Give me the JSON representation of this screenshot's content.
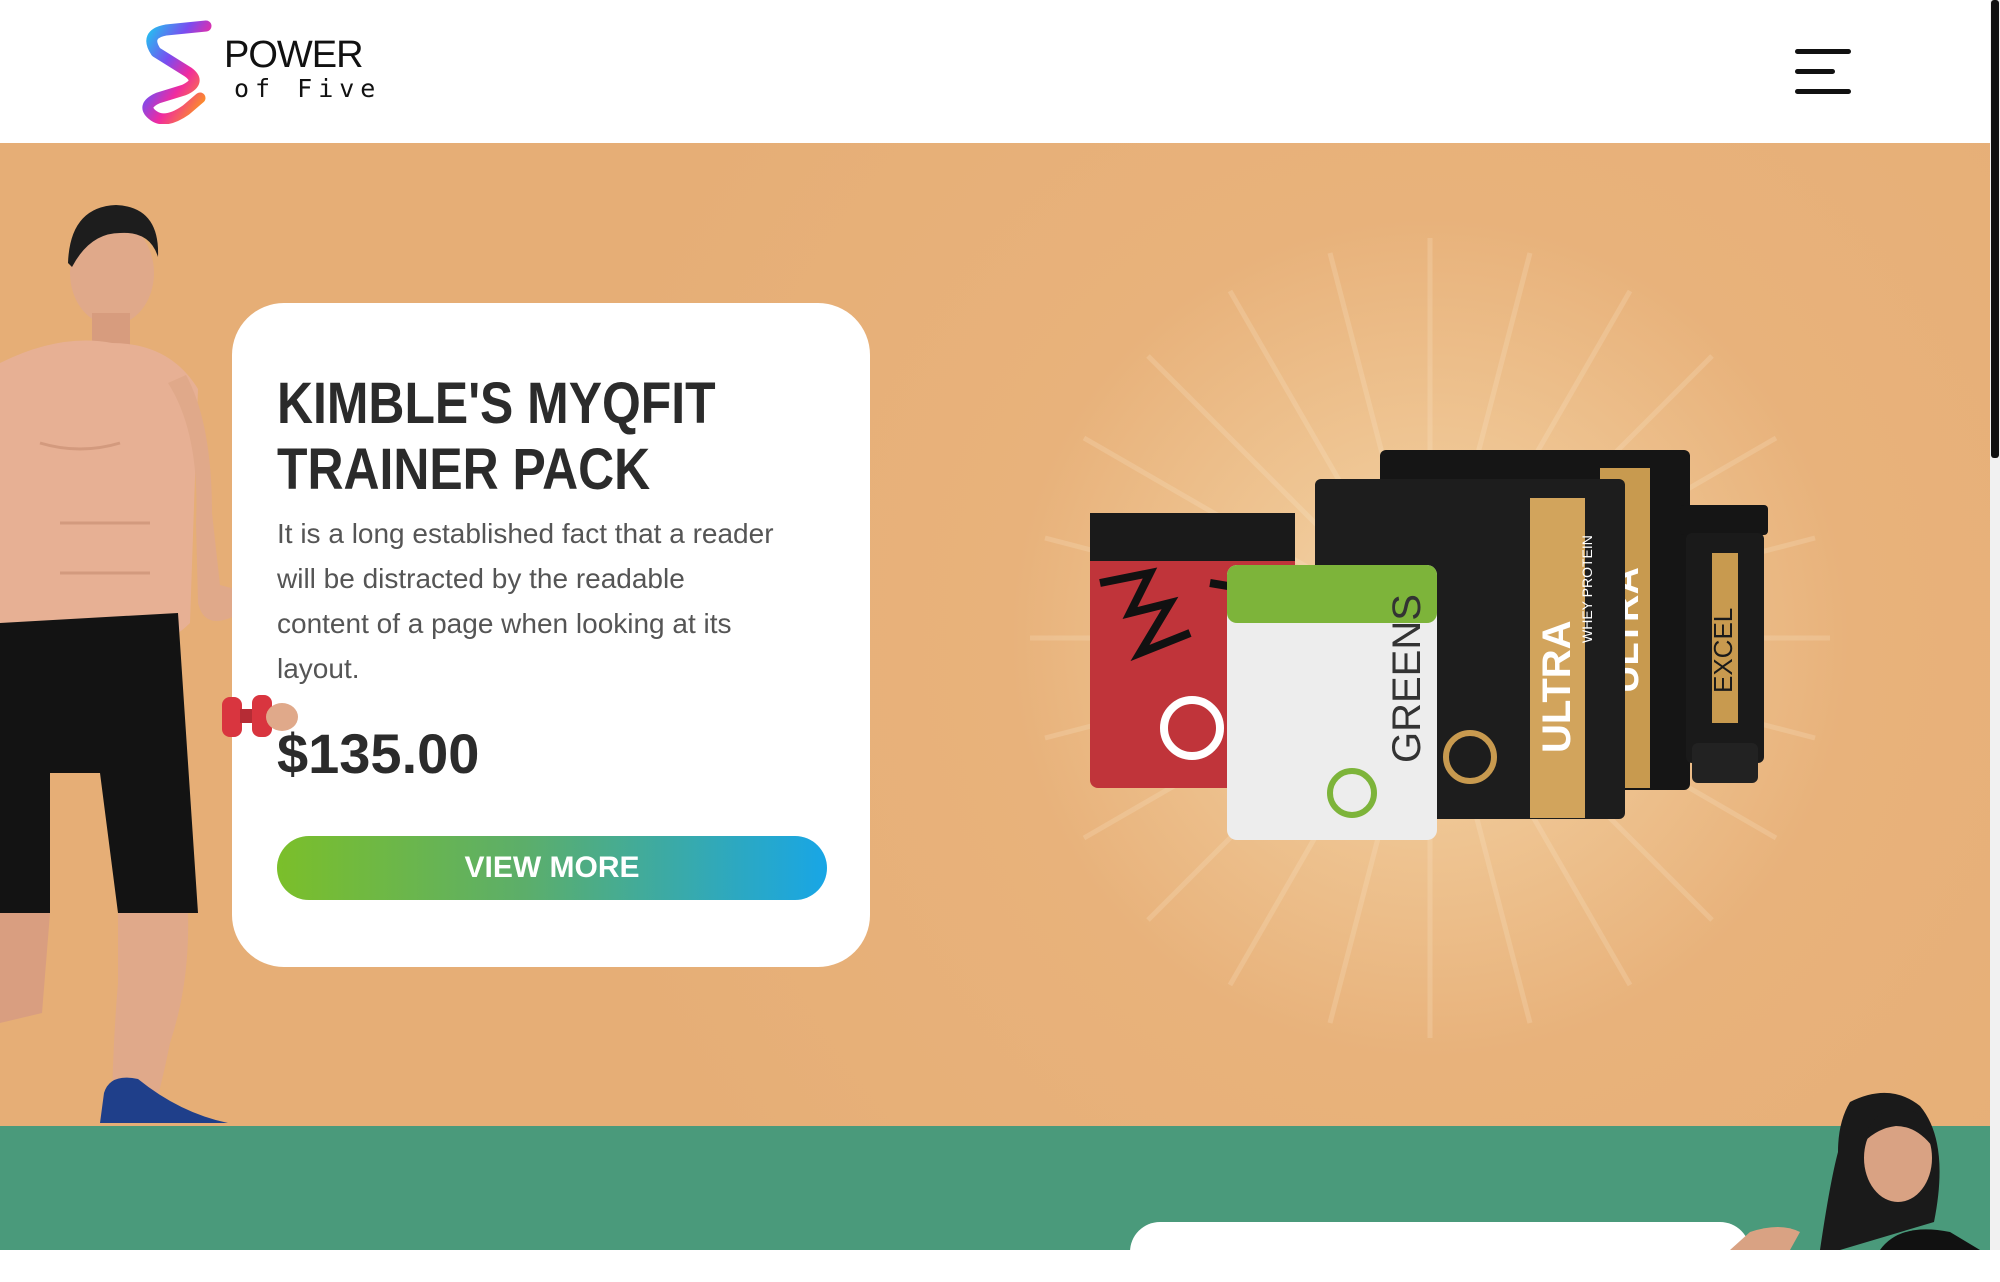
{
  "header": {
    "logo": {
      "line1": "POWER",
      "line2": "of Five"
    },
    "menu_icon": "hamburger-menu-icon"
  },
  "hero": {
    "product": {
      "title": "KIMBLE'S MYQFIT TRAINER PACK",
      "description": "It is a long established fact that a reader will be distracted by the readable content of a page when looking at its layout.",
      "price": "$135.00",
      "cta_label": "VIEW MORE"
    },
    "product_image": {
      "packs": [
        {
          "name": "tiger-pack",
          "logo": "Q"
        },
        {
          "name": "greens-pack",
          "label": "GREENS",
          "logo": "Q"
        },
        {
          "name": "protein-pack",
          "label": "ULTRA",
          "subtitle": "WHEY PROTEIN"
        },
        {
          "name": "protein-pack-2",
          "label": "ULTRA",
          "subtitle": "WHEY PROTEIN"
        },
        {
          "name": "excel-tube",
          "label": "EXCEL"
        }
      ]
    }
  },
  "colors": {
    "hero_bg": "#e6ae76",
    "green_section_bg": "#4a9a7b",
    "button_gradient_start": "#7bbf2a",
    "button_gradient_end": "#18a6e6",
    "title_color": "#2b2b2b"
  }
}
